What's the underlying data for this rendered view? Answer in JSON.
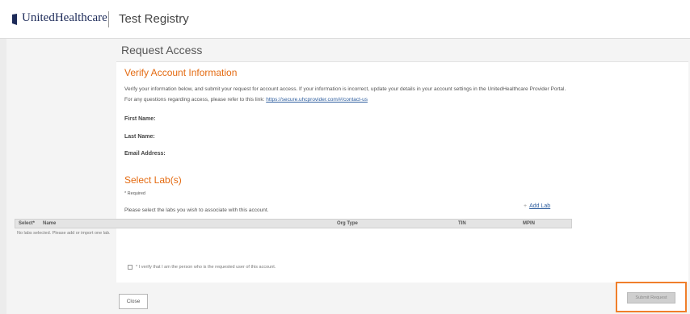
{
  "header": {
    "brand": "UnitedHealthcare",
    "app_name": "Test Registry",
    "logo_icon": "uhc-shield-icon"
  },
  "page": {
    "title": "Request Access"
  },
  "verify": {
    "title": "Verify Account Information",
    "intro_line1": "Verify your information below, and submit your request for account access. If your information is incorrect, update your details in your account settings in the UnitedHealthcare Provider Portal.",
    "intro_line2_prefix": "For any questions regarding access, please refer to this link: ",
    "contact_link": "https://secure.uhcprovider.com/#/contact-us",
    "first_name_label": "First Name:",
    "last_name_label": "Last Name:",
    "email_label": "Email Address:"
  },
  "labs": {
    "title": "Select Lab(s)",
    "required_note": "* Required",
    "instruction": "Please select the labs you wish to associate with this account.",
    "add_lab": "Add Lab",
    "add_lab_icon": "plus-icon",
    "columns": [
      "Select*",
      "Name",
      "Org Type",
      "TIN",
      "MPIN"
    ],
    "empty_message": "No labs selected. Please add or import one lab."
  },
  "attestation": {
    "text": "* I verify that I am the person who is the requested user of this account."
  },
  "buttons": {
    "close": "Close",
    "submit": "Submit Request"
  },
  "colors": {
    "accent": "#e46b12",
    "link": "#2d5d9e",
    "highlight": "#f07f2b",
    "brand": "#1d2b59"
  }
}
